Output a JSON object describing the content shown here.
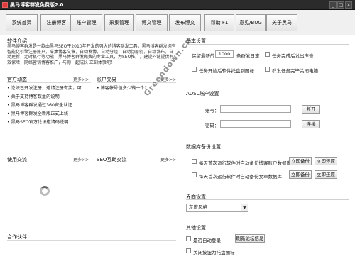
{
  "window": {
    "title": "黑马博客群发免费版2.0",
    "min": "_",
    "max": "□",
    "close": "×"
  },
  "toolbar": [
    "系统首页",
    "注册博客",
    "账户管理",
    "采集管理",
    "博文管理",
    "发布博文",
    "帮助 F1",
    "意见/BUG",
    "关于黑马"
  ],
  "intro": {
    "title": "软件介绍",
    "text": "黑马博客群发是一款由黑马SEO于2010年开发的强大的博客群发工具，黑马博客群发拥有智能化引擎注册账户，采集博客文章，自动发博，自动分组，自动伪原创，自动发布，自动更新，定时执行等功能，黑马博客群发免费的专业工具，为SEO推广，建设外链提供有效保障，网络营销博客推广，与你一起成长 立刻体验吧！"
  },
  "news": {
    "title": "官方动态",
    "more": "更多>>",
    "items": [
      "论坛已开发注册，邀请注册有奖，可…",
      "关于支持博客数量的说明",
      "黑马博客群发通过360安全认证",
      "黑马博客群发全新版正式上线",
      "黑马SEO官方论坛邀请码说明"
    ]
  },
  "account_trade": {
    "title": "账户交易",
    "more": "更多>>",
    "items": [
      "博客帐号值多少钱一个?"
    ]
  },
  "usage": {
    "title": "使用交流",
    "more": "更多>>"
  },
  "seo": {
    "title": "SEO互助交流",
    "more": "更多>>"
  },
  "partners": {
    "title": "合作伙伴"
  },
  "basic": {
    "title": "基本设置",
    "keep_label": "保留最新的",
    "keep_value": "1000",
    "keep_suffix": "条群发日志",
    "sound_label": "任务完成后发出声音",
    "tray_label": "任务开始后软件托盘到图标",
    "shutdown_label": "群发任务完毕关闭电脑"
  },
  "ads": {
    "title": "ADSL账户设置",
    "account_label": "账号：",
    "password_label": "密码：",
    "disconnect": "断开",
    "connect": "连接"
  },
  "backup": {
    "title": "数据库备份设置",
    "row1": "每天首次运行软件时自动备份博客账户数据库",
    "row2": "每天首次运行软件时自动备份文章数据库",
    "backup_btn": "立即备份",
    "restore_btn": "立即还原"
  },
  "ui": {
    "title": "界面设置",
    "style_value": "灰度风格"
  },
  "other": {
    "title": "其他设置",
    "autologin": "是否自动登录",
    "refresh": "刷新论坛信息",
    "tray": "关闭按钮为托盘图标"
  },
  "watermark": "Greendown.cn"
}
